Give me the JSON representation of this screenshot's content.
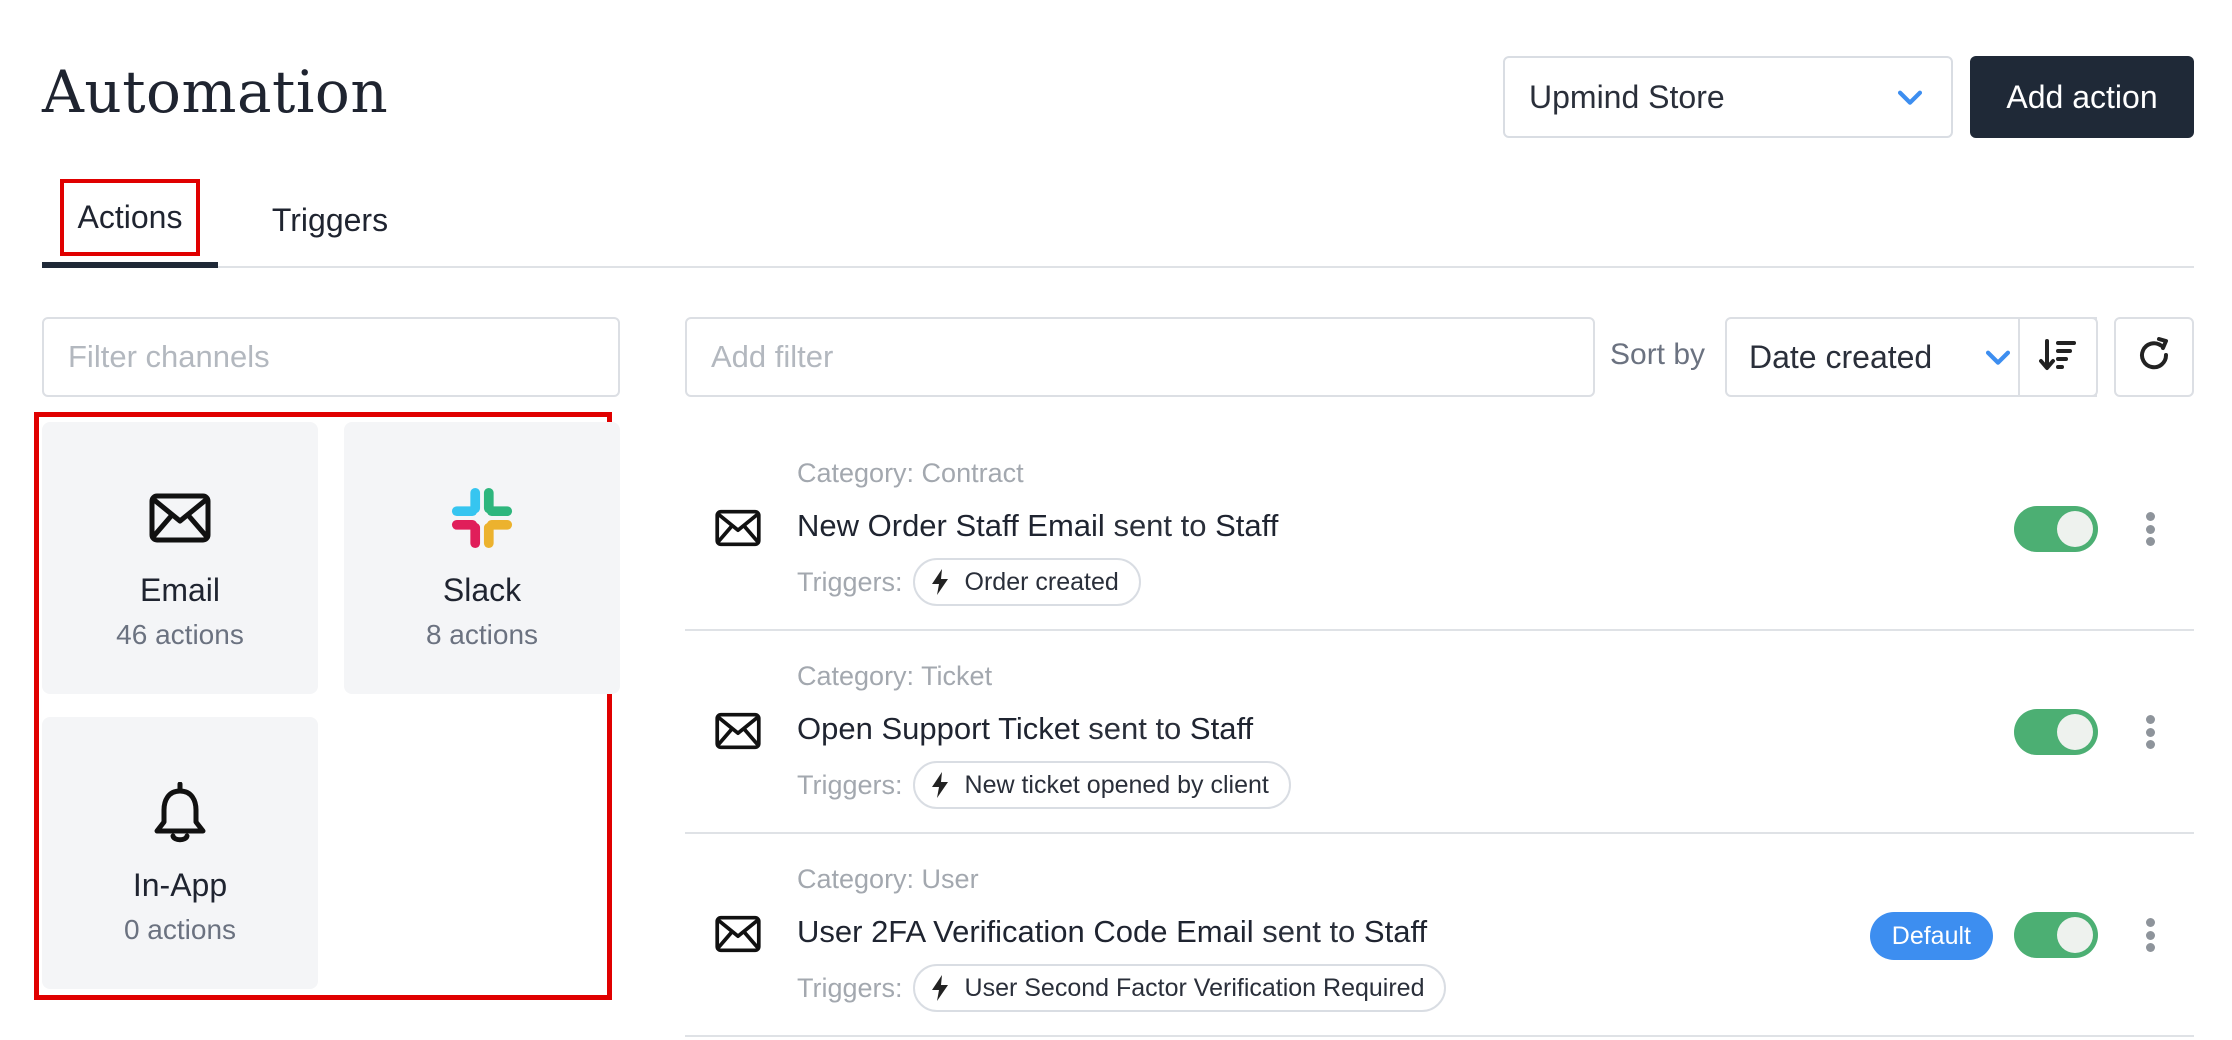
{
  "header": {
    "title": "Automation",
    "store_select": "Upmind Store",
    "add_action_label": "Add action"
  },
  "tabs": [
    {
      "label": "Actions",
      "active": true
    },
    {
      "label": "Triggers",
      "active": false
    }
  ],
  "channels": {
    "filter_placeholder": "Filter channels",
    "items": [
      {
        "name": "Email",
        "count": "46 actions",
        "icon": "envelope-icon"
      },
      {
        "name": "Slack",
        "count": "8 actions",
        "icon": "slack-logo-icon"
      },
      {
        "name": "In-App",
        "count": "0 actions",
        "icon": "bell-icon"
      }
    ]
  },
  "toolbar": {
    "filter_placeholder": "Add filter",
    "sort_by_label": "Sort by",
    "sort_value": "Date created"
  },
  "actions": [
    {
      "category": "Category: Contract",
      "name": "New Order Staff Email",
      "sent_to_text": "sent to",
      "recipient": "Staff",
      "triggers_label": "Triggers:",
      "trigger": "Order created",
      "enabled": true
    },
    {
      "category": "Category: Ticket",
      "name": "Open Support Ticket",
      "sent_to_text": "sent to",
      "recipient": "Staff",
      "triggers_label": "Triggers:",
      "trigger": "New ticket opened by client",
      "enabled": true
    },
    {
      "category": "Category: User",
      "name": "User 2FA Verification Code Email",
      "sent_to_text": "sent to",
      "recipient": "Staff",
      "triggers_label": "Triggers:",
      "trigger": "User Second Factor Verification Required",
      "badge": "Default",
      "enabled": true
    }
  ],
  "colors": {
    "primary_dark": "#1f2937",
    "accent_blue": "#3d8ef0",
    "toggle_on": "#4caf73",
    "highlight_red": "#e00000"
  }
}
